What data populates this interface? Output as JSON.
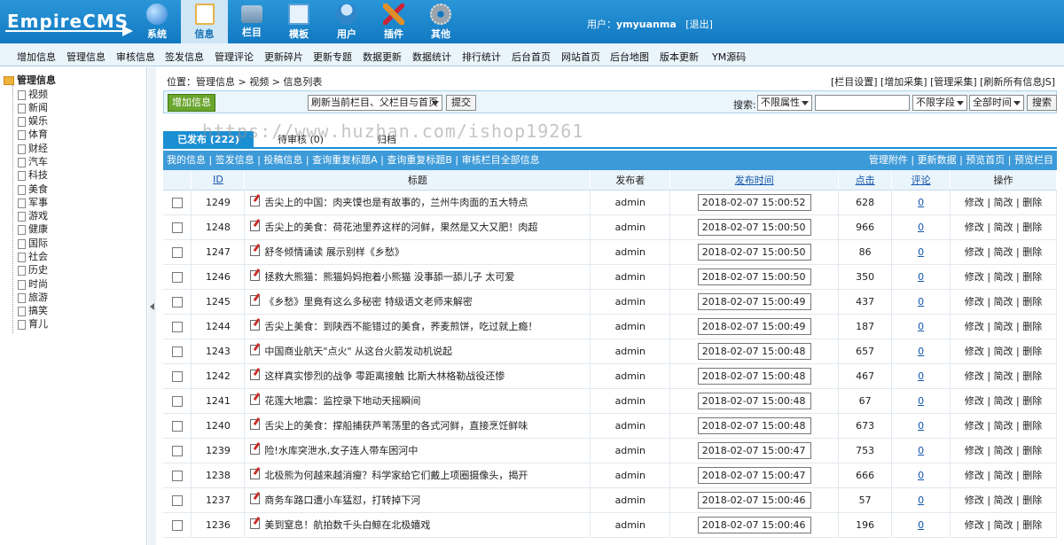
{
  "app": {
    "logo_text": "EmpireCMS",
    "nav": [
      {
        "label": "系统",
        "icon": "globe-icon",
        "color": "#2a7dd4"
      },
      {
        "label": "信息",
        "icon": "edit-icon",
        "color": "#e8b24a",
        "active": true
      },
      {
        "label": "栏目",
        "icon": "folder-icon",
        "color": "#6b8fb1"
      },
      {
        "label": "模板",
        "icon": "window-icon",
        "color": "#5aa0d8"
      },
      {
        "label": "用户",
        "icon": "user-icon",
        "color": "#2f86c9"
      },
      {
        "label": "插件",
        "icon": "tools-icon",
        "color": "#e0902a"
      },
      {
        "label": "其他",
        "icon": "gear-icon",
        "color": "#9aa4ad"
      }
    ],
    "user_label": "用户：",
    "username": "ymyuanma",
    "logout": "[退出]"
  },
  "subnav": [
    "增加信息",
    "管理信息",
    "审核信息",
    "签发信息",
    "管理评论",
    "更新碎片",
    "更新专题",
    "数据更新",
    "数据统计",
    "排行统计",
    "后台首页",
    "网站首页",
    "后台地图",
    "版本更新",
    "YM源码"
  ],
  "sidebar": {
    "root": "管理信息",
    "items": [
      "视频",
      "新闻",
      "娱乐",
      "体育",
      "财经",
      "汽车",
      "科技",
      "美食",
      "军事",
      "游戏",
      "健康",
      "国际",
      "社会",
      "历史",
      "时尚",
      "旅游",
      "搞笑",
      "育儿"
    ]
  },
  "breadcrumb": {
    "prefix": "位置：",
    "manage": "管理信息",
    "sep": " > ",
    "section": "视频",
    "page": "信息列表"
  },
  "quicklinks": "[栏目设置] [增加采集] [管理采集] [刷新所有信息JS]",
  "toolbar": {
    "add_button": "增加信息",
    "refresh_select": "刷新当前栏目、父栏目与首页",
    "submit_button": "提交",
    "search_label": "搜索:",
    "attr_select": "不限属性",
    "search_placeholder": "",
    "field_select": "不限字段",
    "time_select": "全部时间",
    "search_button": "搜索"
  },
  "watermark": "https://www.huzhan.com/ishop19261",
  "tabs": {
    "published": "已发布 (222)",
    "pending": "待审核 (0)",
    "archived": "归档"
  },
  "actionbar": {
    "left": "我的信息 | 签发信息 | 投稿信息 | 查询重复标题A | 查询重复标题B | 审核栏目全部信息",
    "right": "管理附件 | 更新数据 | 预览首页 | 预览栏目"
  },
  "table": {
    "headers": {
      "id": "ID",
      "title": "标题",
      "author": "发布者",
      "time": "发布时间",
      "clicks": "点击",
      "comments": "评论",
      "ops": "操作"
    },
    "op_labels": {
      "edit": "修改",
      "simple_edit": "简改",
      "delete": "删除",
      "sep": " | "
    },
    "rows": [
      {
        "id": "1249",
        "title": "舌尖上的中国：肉夹馍也是有故事的，兰州牛肉面的五大特点",
        "author": "admin",
        "time": "2018-02-07 15:00:52",
        "clicks": "628",
        "comments": "0"
      },
      {
        "id": "1248",
        "title": "舌尖上的美食：荷花池里养这样的河鲜，果然是又大又肥！肉超",
        "author": "admin",
        "time": "2018-02-07 15:00:50",
        "clicks": "966",
        "comments": "0"
      },
      {
        "id": "1247",
        "title": "舒冬倾情诵读 展示别样《乡愁》",
        "author": "admin",
        "time": "2018-02-07 15:00:50",
        "clicks": "86",
        "comments": "0"
      },
      {
        "id": "1246",
        "title": "拯救大熊猫：熊猫妈妈抱着小熊猫 没事舔一舔儿子 太可爱",
        "author": "admin",
        "time": "2018-02-07 15:00:50",
        "clicks": "350",
        "comments": "0"
      },
      {
        "id": "1245",
        "title": "《乡愁》里竟有这么多秘密 特级语文老师来解密",
        "author": "admin",
        "time": "2018-02-07 15:00:49",
        "clicks": "437",
        "comments": "0"
      },
      {
        "id": "1244",
        "title": "舌尖上美食：到陕西不能错过的美食，荞麦煎饼，吃过就上瘾！",
        "author": "admin",
        "time": "2018-02-07 15:00:49",
        "clicks": "187",
        "comments": "0"
      },
      {
        "id": "1243",
        "title": "中国商业航天\"点火\" 从这台火箭发动机说起",
        "author": "admin",
        "time": "2018-02-07 15:00:48",
        "clicks": "657",
        "comments": "0"
      },
      {
        "id": "1242",
        "title": "这样真实惨烈的战争 零距离接触 比斯大林格勒战役还惨",
        "author": "admin",
        "time": "2018-02-07 15:00:48",
        "clicks": "467",
        "comments": "0"
      },
      {
        "id": "1241",
        "title": "花莲大地震：监控录下地动天摇瞬间",
        "author": "admin",
        "time": "2018-02-07 15:00:48",
        "clicks": "67",
        "comments": "0"
      },
      {
        "id": "1240",
        "title": "舌尖上的美食：撑船捕获芦苇荡里的各式河鲜，直接烹饪鲜味",
        "author": "admin",
        "time": "2018-02-07 15:00:48",
        "clicks": "673",
        "comments": "0"
      },
      {
        "id": "1239",
        "title": "险!水库突泄水,女子连人带车困河中",
        "author": "admin",
        "time": "2018-02-07 15:00:47",
        "clicks": "753",
        "comments": "0"
      },
      {
        "id": "1238",
        "title": "北极熊为何越来越消瘦？科学家给它们戴上项圈摄像头，揭开",
        "author": "admin",
        "time": "2018-02-07 15:00:47",
        "clicks": "666",
        "comments": "0"
      },
      {
        "id": "1237",
        "title": "商务车路口遭小车猛怼，打转掉下河",
        "author": "admin",
        "time": "2018-02-07 15:00:46",
        "clicks": "57",
        "comments": "0"
      },
      {
        "id": "1236",
        "title": "美到窒息！航拍数千头白鲸在北极嬉戏",
        "author": "admin",
        "time": "2018-02-07 15:00:46",
        "clicks": "196",
        "comments": "0"
      }
    ]
  }
}
